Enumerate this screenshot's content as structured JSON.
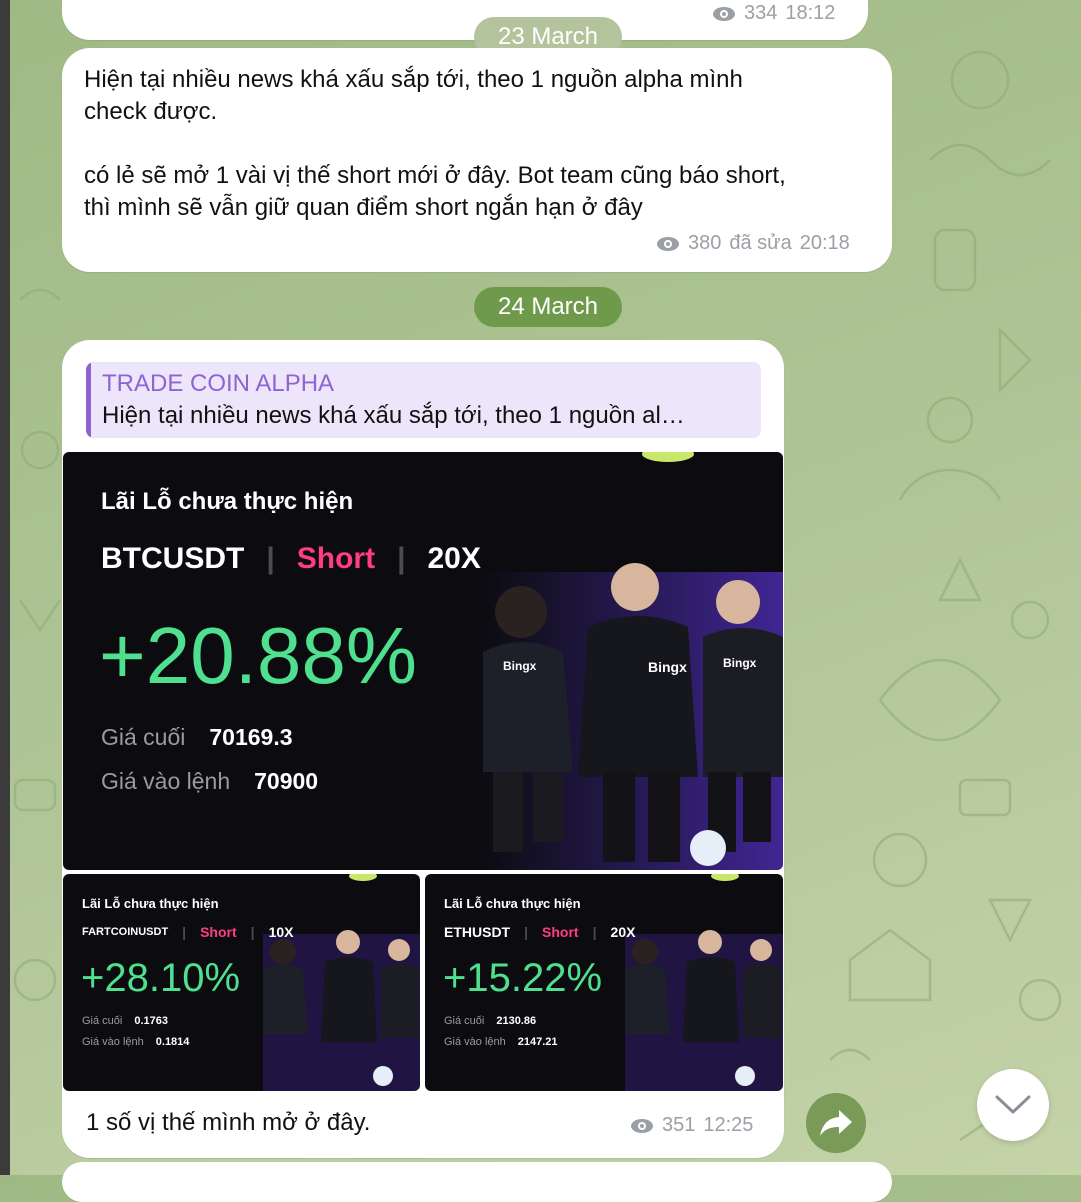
{
  "messages": {
    "prev": {
      "views": "334",
      "time": "18:12"
    },
    "m1": {
      "date": "23 March",
      "lines": [
        "Hiện tại nhiều news khá xấu sắp tới, theo 1 nguồn alpha mình",
        "check được.",
        "",
        "có lẻ sẽ mở 1 vài vị thế short mới ở đây. Bot team cũng báo short,",
        "thì mình sẽ vẫn giữ quan điểm short ngắn hạn ở đây"
      ],
      "views": "380",
      "edited": "đã sửa",
      "time": "20:18"
    },
    "m2": {
      "date": "24 March",
      "reply_channel": "TRADE COIN ALPHA",
      "reply_preview": "Hiện tại nhiều news khá xấu sắp tới, theo 1 nguồn al…",
      "caption": "1 số vị thế mình mở ở đây.",
      "views": "351",
      "time": "12:25"
    }
  },
  "cards": [
    {
      "title": "Lãi Lỗ chưa thực hiện",
      "pair": "BTCUSDT",
      "side": "Short",
      "leverage": "20X",
      "pnl": "+20.88%",
      "last_label": "Giá cuối",
      "last_price": "70169.3",
      "entry_label": "Giá vào lệnh",
      "entry_price": "70900",
      "brand": "Bingx"
    },
    {
      "title": "Lãi Lỗ chưa thực hiện",
      "pair": "FARTCOINUSDT",
      "side": "Short",
      "leverage": "10X",
      "pnl": "+28.10%",
      "last_label": "Giá cuối",
      "last_price": "0.1763",
      "entry_label": "Giá vào lệnh",
      "entry_price": "0.1814",
      "brand": "Bingx"
    },
    {
      "title": "Lãi Lỗ chưa thực hiện",
      "pair": "ETHUSDT",
      "side": "Short",
      "leverage": "20X",
      "pnl": "+15.22%",
      "last_label": "Giá cuối",
      "last_price": "2130.86",
      "entry_label": "Giá vào lệnh",
      "entry_price": "2147.21",
      "brand": "Bingx"
    }
  ],
  "colors": {
    "accent": "#8e63d2",
    "profit": "#4ee08f",
    "short": "#ff3d7f",
    "date_pill_1": "#b3c49c",
    "date_pill_2": "#6f9a4c"
  }
}
